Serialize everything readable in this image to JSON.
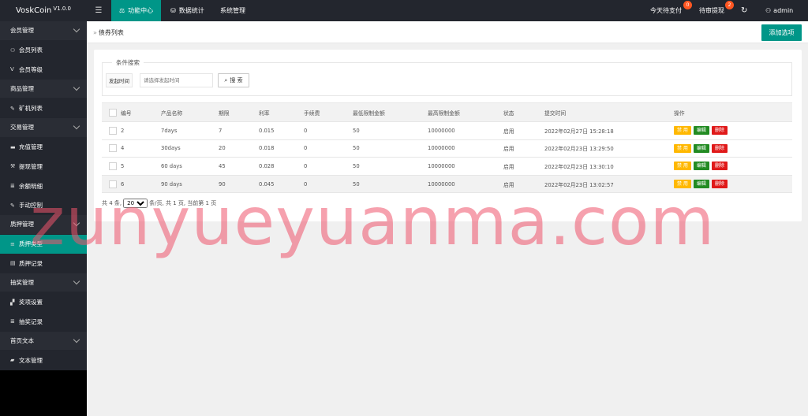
{
  "app": {
    "name": "VoskCoin",
    "version": "V1.0.0"
  },
  "topnav": {
    "menu_icon": "hamburger-icon",
    "items": [
      {
        "label": "功能中心",
        "icon": "scale-icon"
      },
      {
        "label": "数据统计",
        "icon": "database-icon"
      },
      {
        "label": "系统管理",
        "icon": ""
      }
    ],
    "pending_pay": {
      "label": "今天待支付",
      "badge": "0"
    },
    "pending_review": {
      "label": "待审提现",
      "badge": "2"
    },
    "refresh_icon": "refresh-icon",
    "user": {
      "name": "admin",
      "icon": "user-icon"
    }
  },
  "sidebar": {
    "groups": [
      {
        "label": "会员管理",
        "items": [
          {
            "label": "会员列表",
            "icon": "user-icon"
          },
          {
            "label": "会员等级",
            "icon": "v-icon"
          }
        ]
      },
      {
        "label": "商品管理",
        "items": [
          {
            "label": "矿机列表",
            "icon": "edit-icon"
          }
        ]
      },
      {
        "label": "交易管理",
        "items": [
          {
            "label": "充值管理",
            "icon": "card-icon"
          },
          {
            "label": "提现管理",
            "icon": "hammer-icon"
          },
          {
            "label": "余额明细",
            "icon": "list-icon"
          },
          {
            "label": "手动控制",
            "icon": "edit-icon"
          }
        ]
      },
      {
        "label": "质押管理",
        "items": [
          {
            "label": "质押类型",
            "icon": "bars-icon",
            "active": true
          },
          {
            "label": "质押记录",
            "icon": "table-icon"
          }
        ]
      },
      {
        "label": "抽奖管理",
        "items": [
          {
            "label": "奖项设置",
            "icon": "grid-icon"
          },
          {
            "label": "抽奖记录",
            "icon": "list-icon"
          }
        ]
      },
      {
        "label": "首页文本",
        "items": [
          {
            "label": "文本管理",
            "icon": "book-icon"
          }
        ]
      }
    ]
  },
  "page": {
    "breadcrumb": "债券列表",
    "add_button": "添加选项"
  },
  "filter": {
    "legend": "条件搜索",
    "label": "发起时间",
    "placeholder": "请选择发起时间",
    "search_button": "搜 索"
  },
  "table": {
    "headers": [
      "编号",
      "产品名称",
      "期限",
      "利率",
      "手续费",
      "最低限制金额",
      "最高限制金额",
      "状态",
      "提交时间",
      "操作"
    ],
    "rows": [
      {
        "id": "2",
        "name": "7days",
        "term": "7",
        "rate": "0.015",
        "fee": "0",
        "min": "50",
        "max": "10000000",
        "status": "启用",
        "time": "2022年02月27日 15:28:18"
      },
      {
        "id": "4",
        "name": "30days",
        "term": "20",
        "rate": "0.018",
        "fee": "0",
        "min": "50",
        "max": "10000000",
        "status": "启用",
        "time": "2022年02月23日 13:29:50"
      },
      {
        "id": "5",
        "name": "60 days",
        "term": "45",
        "rate": "0.028",
        "fee": "0",
        "min": "50",
        "max": "10000000",
        "status": "启用",
        "time": "2022年02月23日 13:30:10"
      },
      {
        "id": "6",
        "name": "90 days",
        "term": "90",
        "rate": "0.045",
        "fee": "0",
        "min": "50",
        "max": "10000000",
        "status": "启用",
        "time": "2022年02月23日 13:02:57"
      }
    ],
    "actions": {
      "disable": "禁 用",
      "edit": "编辑",
      "delete": "删除"
    }
  },
  "pager": {
    "total_prefix": "共 4 条,",
    "page_size": "20",
    "suffix": "条/页, 共 1 页, 当前第 1 页"
  },
  "watermark": "zunyueyuanma.com",
  "colors": {
    "accent": "#009688",
    "topbar": "#23262e",
    "warn": "#ffb800",
    "danger": "#e01a1a",
    "ok": "#228b22"
  }
}
